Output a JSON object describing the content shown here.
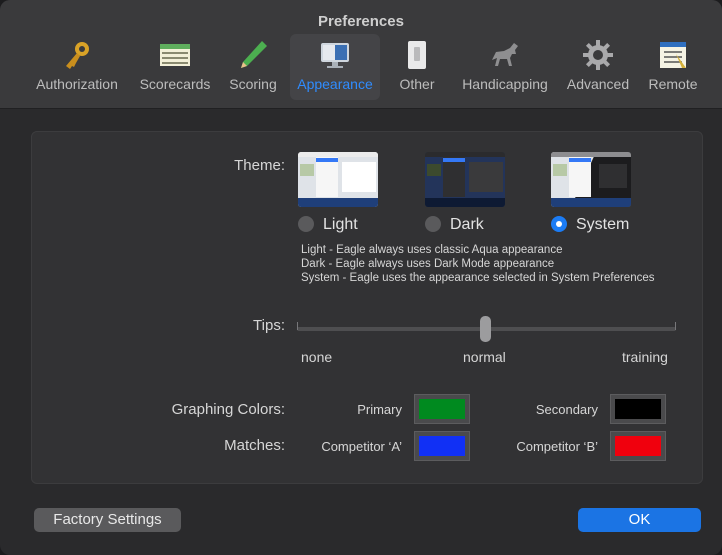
{
  "window": {
    "title": "Preferences"
  },
  "toolbar": {
    "items": [
      {
        "label": "Authorization",
        "icon": "key-icon"
      },
      {
        "label": "Scorecards",
        "icon": "scorecard-icon"
      },
      {
        "label": "Scoring",
        "icon": "pencil-icon"
      },
      {
        "label": "Appearance",
        "icon": "monitor-icon",
        "selected": true
      },
      {
        "label": "Other",
        "icon": "switch-icon"
      },
      {
        "label": "Handicapping",
        "icon": "horse-icon"
      },
      {
        "label": "Advanced",
        "icon": "gear-icon"
      },
      {
        "label": "Remote",
        "icon": "remote-icon"
      }
    ]
  },
  "theme": {
    "label": "Theme:",
    "options": [
      {
        "label": "Light",
        "selected": false
      },
      {
        "label": "Dark",
        "selected": false
      },
      {
        "label": "System",
        "selected": true
      }
    ],
    "descriptions": [
      "Light - Eagle always uses classic Aqua appearance",
      "Dark - Eagle always uses Dark Mode appearance",
      "System - Eagle uses the appearance selected in System Preferences"
    ]
  },
  "tips": {
    "label": "Tips:",
    "min_label": "none",
    "mid_label": "normal",
    "max_label": "training",
    "value": "normal"
  },
  "graphing": {
    "label": "Graphing Colors:",
    "primary_label": "Primary",
    "primary_color": "#008a1f",
    "secondary_label": "Secondary",
    "secondary_color": "#000000"
  },
  "matches": {
    "label": "Matches:",
    "a_label": "Competitor ‘A’",
    "a_color": "#1130f5",
    "b_label": "Competitor ‘B’",
    "b_color": "#f0000d"
  },
  "buttons": {
    "factory": "Factory Settings",
    "ok": "OK"
  }
}
